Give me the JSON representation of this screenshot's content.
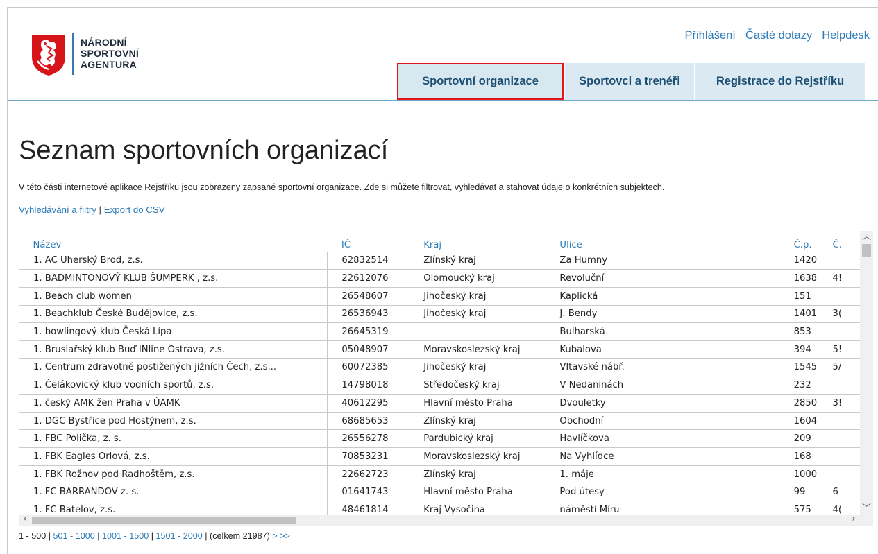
{
  "brand": {
    "logo_lines": [
      "NÁRODNÍ",
      "SPORTOVNÍ",
      "AGENTURA"
    ],
    "accent": "#2b7bb9",
    "highlight": "#e3151a"
  },
  "toplinks": [
    "Přihlášení",
    "Časté dotazy",
    "Helpdesk"
  ],
  "tabs": [
    "Sportovní organizace",
    "Sportovci a trenéři",
    "Registrace do Rejstříku"
  ],
  "page": {
    "title": "Seznam sportovních organizací",
    "intro": "V této části internetové aplikace Rejstříku jsou zobrazeny zapsané sportovní organizace. Zde si můžete filtrovat, vyhledávat a stahovat údaje o konkrétních subjektech.",
    "link_search": "Vyhledávání a filtry",
    "link_sep": " | ",
    "link_export": "Export do CSV"
  },
  "table": {
    "headers": [
      "Název",
      "IČ",
      "Kraj",
      "Ulice",
      "Č.p.",
      "Č."
    ],
    "rows": [
      [
        "1. AC Uherský Brod, z.s.",
        "62832514",
        "Zlínský kraj",
        "Za Humny",
        "1420",
        ""
      ],
      [
        "1. BADMINTONOVÝ KLUB ŠUMPERK , z.s.",
        "22612076",
        "Olomoucký kraj",
        "Revoluční",
        "1638",
        "4!"
      ],
      [
        "1. Beach club women",
        "26548607",
        "Jihočeský kraj",
        "Kaplická",
        "151",
        ""
      ],
      [
        "1. Beachklub České Budějovice, z.s.",
        "26536943",
        "Jihočeský kraj",
        "J. Bendy",
        "1401",
        "3("
      ],
      [
        "1. bowlingový klub Česká Lípa",
        "26645319",
        "",
        "Bulharská",
        "853",
        ""
      ],
      [
        "1. Bruslařský klub Buď INline Ostrava, z.s.",
        "05048907",
        "Moravskoslezský kraj",
        "Kubalova",
        "394",
        "5!"
      ],
      [
        "1. Centrum zdravotně postižených jižních Čech, z.s...",
        "60072385",
        "Jihočeský kraj",
        "Vltavské nábř.",
        "1545",
        "5/"
      ],
      [
        "1. Čelákovický klub vodních sportů, z.s.",
        "14798018",
        "Středočeský kraj",
        "V Nedaninách",
        "232",
        ""
      ],
      [
        "1. český AMK žen Praha v ÚAMK",
        "40612295",
        "Hlavní město Praha",
        "Dvouletky",
        "2850",
        "3!"
      ],
      [
        "1. DGC Bystřice pod Hostýnem, z.s.",
        "68685653",
        "Zlínský kraj",
        "Obchodní",
        "1604",
        ""
      ],
      [
        "1. FBC Polička, z. s.",
        "26556278",
        "Pardubický kraj",
        "Havlíčkova",
        "209",
        ""
      ],
      [
        "1. FBK Eagles Orlová, z.s.",
        "70853231",
        "Moravskoslezský kraj",
        "Na Vyhlídce",
        "168",
        ""
      ],
      [
        "1. FBK Rožnov pod Radhoštěm, z.s.",
        "22662723",
        "Zlínský kraj",
        "1. máje",
        "1000",
        ""
      ],
      [
        "1. FC BARRANDOV z. s.",
        "01641743",
        "Hlavní město Praha",
        "Pod útesy",
        "99",
        "6"
      ],
      [
        "1. FC Batelov, z.s.",
        "48461814",
        "Kraj Vysočina",
        "náměstí Míru",
        "575",
        "4("
      ]
    ]
  },
  "pager": {
    "current": "1 - 500",
    "pages": [
      "501 - 1000",
      "1001 - 1500",
      "1501 - 2000"
    ],
    "total": "(celkem 21987)",
    "next": "> >>"
  }
}
